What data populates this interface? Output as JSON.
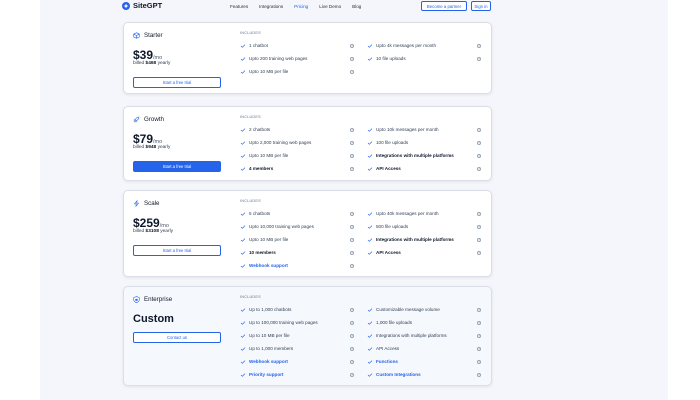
{
  "nav": {
    "brand": "SiteGPT",
    "links": [
      "Features",
      "Integrations",
      "Pricing",
      "Live Demo",
      "Blog"
    ],
    "active": "Pricing",
    "partner_label": "Become a partner",
    "signin_label": "Sign in"
  },
  "includes_label": "INCLUDES",
  "info_glyph": "i",
  "accent": "#2563eb",
  "plans": [
    {
      "name": "Starter",
      "icon": "cube-icon",
      "price": "$39",
      "per": "/mo",
      "billed_prefix": "billed",
      "billed_amount": "$468",
      "billed_suffix": "yearly",
      "cta": "Start a free trial",
      "features_left": [
        "1 chatbot",
        "Upto 200 training web pages",
        "Upto 10 MB per file"
      ],
      "features_right": [
        "Upto 4k messages per month",
        "10 file uploads"
      ]
    },
    {
      "name": "Growth",
      "icon": "rocket-icon",
      "price": "$79",
      "per": "/mo",
      "billed_prefix": "billed",
      "billed_amount": "$948",
      "billed_suffix": "yearly",
      "cta": "Start a free trial",
      "features_left": [
        "2 chatbots",
        "Upto 2,000 training web pages",
        "Upto 10 MB per file",
        "4 members"
      ],
      "features_right": [
        "Upto 10k messages per month",
        "100 file uploads",
        "Integrations with multiple platforms",
        "API Access"
      ]
    },
    {
      "name": "Scale",
      "icon": "bolt-icon",
      "price": "$259",
      "per": "/mo",
      "billed_prefix": "billed",
      "billed_amount": "$3108",
      "billed_suffix": "yearly",
      "cta": "Start a free trial",
      "features_left": [
        "5 chatbots",
        "Upto 10,000 training web pages",
        "Upto 10 MB per file",
        "10 members",
        "Webhook support"
      ],
      "features_right": [
        "Upto 40k messages per month",
        "500 file uploads",
        "Integrations with multiple platforms",
        "API Access"
      ]
    },
    {
      "name": "Enterprise",
      "icon": "shield-icon",
      "price": "Custom",
      "cta": "Contact us",
      "features_left": [
        "Up to 1,000 chatbots",
        "Up to 100,000 training web pages",
        "Up to 10 MB per file",
        "Up to 1,000 members",
        "Webhook support",
        "Priority support"
      ],
      "features_right": [
        "Customizable message volume",
        "1,000 file uploads",
        "Integrations with multiple platforms",
        "API Access",
        "Functions",
        "Custom Integrations"
      ]
    }
  ]
}
